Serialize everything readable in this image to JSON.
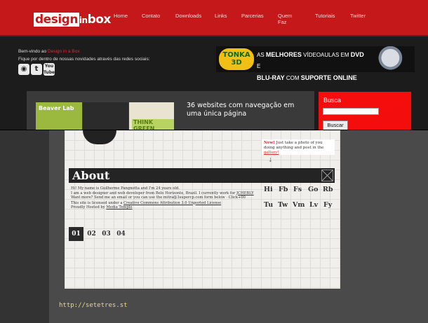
{
  "header": {
    "logo_part1": "design",
    "logo_part2": "in",
    "logo_part3": "box",
    "nav": [
      "Home",
      "Contato",
      "Downloads",
      "Links",
      "Parcerias",
      "Quem Faz",
      "Tutoriais",
      "Twitter"
    ]
  },
  "welcome": {
    "prefix": "Bem-vindo ao ",
    "site_name": "Design in a Box",
    "line2": "Fique por dentro de nossas novidades através das redes sociais:",
    "social_icons": [
      "rss-icon",
      "twitter-icon",
      "youtube-icon"
    ]
  },
  "banner": {
    "brand_line1": "TONKA",
    "brand_line2": "3D",
    "text_line1_a": "AS ",
    "text_line1_b": "MELHORES",
    "text_line1_c": " VÍDEOAULAS EM ",
    "text_line1_d": "DVD",
    "text_line1_e": " E",
    "text_line2_a": "BLU-RAY",
    "text_line2_b": " COM ",
    "text_line2_c": "SUPORTE ONLINE"
  },
  "featured": {
    "thumb1_label": "Beaver Lab",
    "thumb3_label": "THINK GREEN",
    "headline": "36 websites com navegação em uma única página"
  },
  "search": {
    "title": "Busca",
    "button": "Buscar"
  },
  "preview": {
    "new_label": "New!",
    "new_text": " Just take a photo of you doing anything and post in the ",
    "new_link": "gallery!",
    "about_title": "About",
    "bio_line1": "Hi! My name is Guilherme Pangnotta and I'm 24 years old.",
    "bio_line2a": "I am a web designer and web developer from Belo Horizonte, Brazil. I currently work for ",
    "bio_line2b": "JCHEBLY",
    "bio_line3": "Want more? Send me an email or you can use the mitra@3supercp.com form below · Click+00",
    "bio_line4a": "This site is licensed under a ",
    "bio_line4b": "Creative Commons Attribution 3.0 Unported License",
    "bio_line5a": "Proudly Hosted by ",
    "bio_line5b": "Media Temple",
    "social_row1": [
      "Hi",
      "Fb",
      "Fs",
      "Go",
      "Rb"
    ],
    "social_row2": [
      "Tu",
      "Tw",
      "Vm",
      "Lv",
      "Fy"
    ],
    "pages": [
      "01",
      "02",
      "03",
      "04"
    ]
  },
  "source_url": "http://setetres.st",
  "colors": {
    "header_red": "#c4181b",
    "search_red": "#f40d0d",
    "url_color": "#e6d98a"
  }
}
